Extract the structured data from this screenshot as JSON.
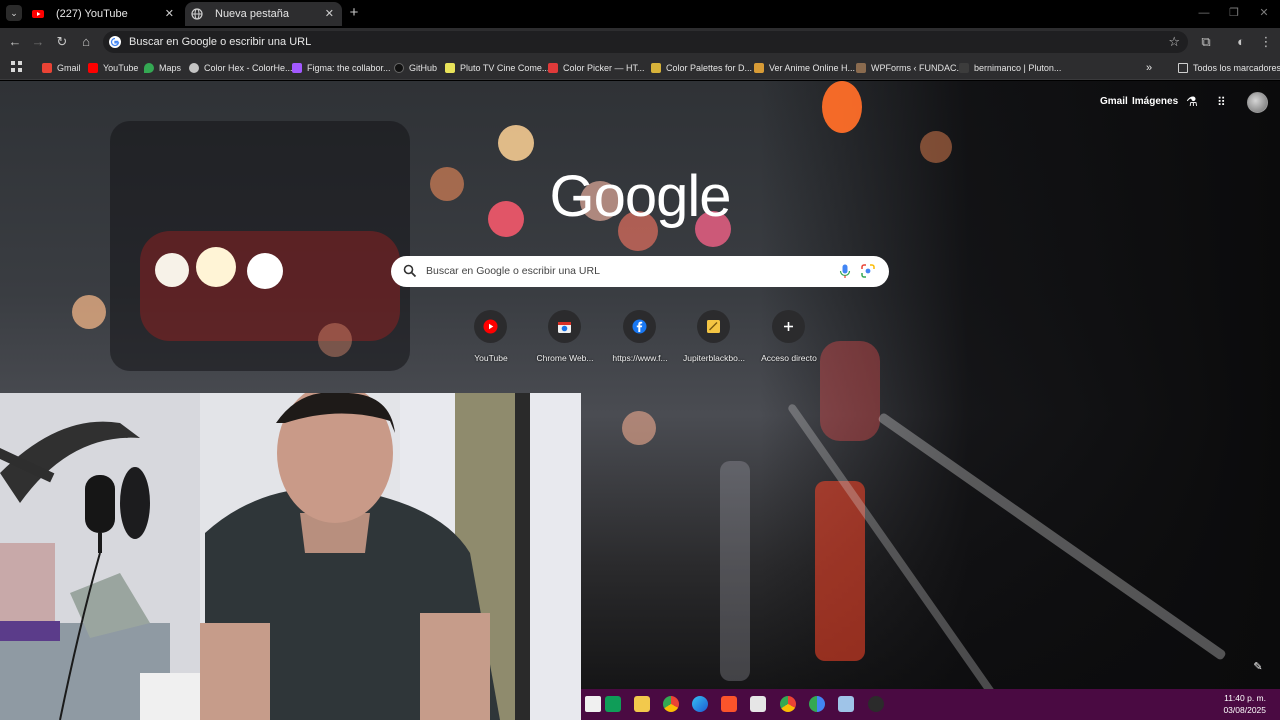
{
  "tabs": [
    {
      "title": "(227) YouTube",
      "active": false
    },
    {
      "title": "Nueva pestaña",
      "active": true
    }
  ],
  "omnibox": {
    "text": "Buscar en Google o escribir una URL"
  },
  "bookmarks": {
    "items": [
      {
        "label": "Gmail",
        "icon": "gmail-icon",
        "color": "#ea4335"
      },
      {
        "label": "YouTube",
        "icon": "youtube-icon",
        "color": "#ff0000"
      },
      {
        "label": "Maps",
        "icon": "maps-icon",
        "color": "#34a853"
      },
      {
        "label": "Color Hex - ColorHe...",
        "icon": "colorhex-icon",
        "color": "#c4c4c4"
      },
      {
        "label": "Figma: the collabor...",
        "icon": "figma-icon",
        "color": "#a259ff"
      },
      {
        "label": "GitHub",
        "icon": "github-icon",
        "color": "#111111"
      },
      {
        "label": "Pluto TV Cine Come...",
        "icon": "plutotv-icon",
        "color": "#e8e35a"
      },
      {
        "label": "Color Picker — HT...",
        "icon": "colorpicker-icon",
        "color": "#e03a3a"
      },
      {
        "label": "Color Palettes for D...",
        "icon": "palettes-icon",
        "color": "#d6b23a"
      },
      {
        "label": "Ver Anime Online H...",
        "icon": "anime-icon",
        "color": "#d79b36"
      },
      {
        "label": "WPForms ‹ FUNDAC...",
        "icon": "wpforms-icon",
        "color": "#8a6b4f"
      },
      {
        "label": "bernimanco | Pluton...",
        "icon": "pluton-icon",
        "color": "#3c3c3c"
      }
    ],
    "more": "»",
    "all_label": "Todos los marcadores"
  },
  "ntp": {
    "gmail_label": "Gmail",
    "images_label": "Imágenes",
    "logo_text": "Google",
    "search_placeholder": "Buscar en Google o escribir una URL",
    "shortcuts": [
      {
        "label": "YouTube",
        "icon": "youtube-icon"
      },
      {
        "label": "Chrome Web...",
        "icon": "chrome-web-store-icon"
      },
      {
        "label": "https://www.f...",
        "icon": "facebook-icon"
      },
      {
        "label": "Jupiterblackbo...",
        "icon": "notes-icon"
      },
      {
        "label": "Acceso directo",
        "icon": "plus-icon"
      }
    ]
  },
  "taskbar": {
    "time": "11:40 p. m.",
    "date": "03/08/2025"
  },
  "colors": {
    "tab_bar": "#000000",
    "toolbar": "#2d2d2f",
    "taskbar": "#4a0a42",
    "accent_red": "#ff3b30"
  }
}
